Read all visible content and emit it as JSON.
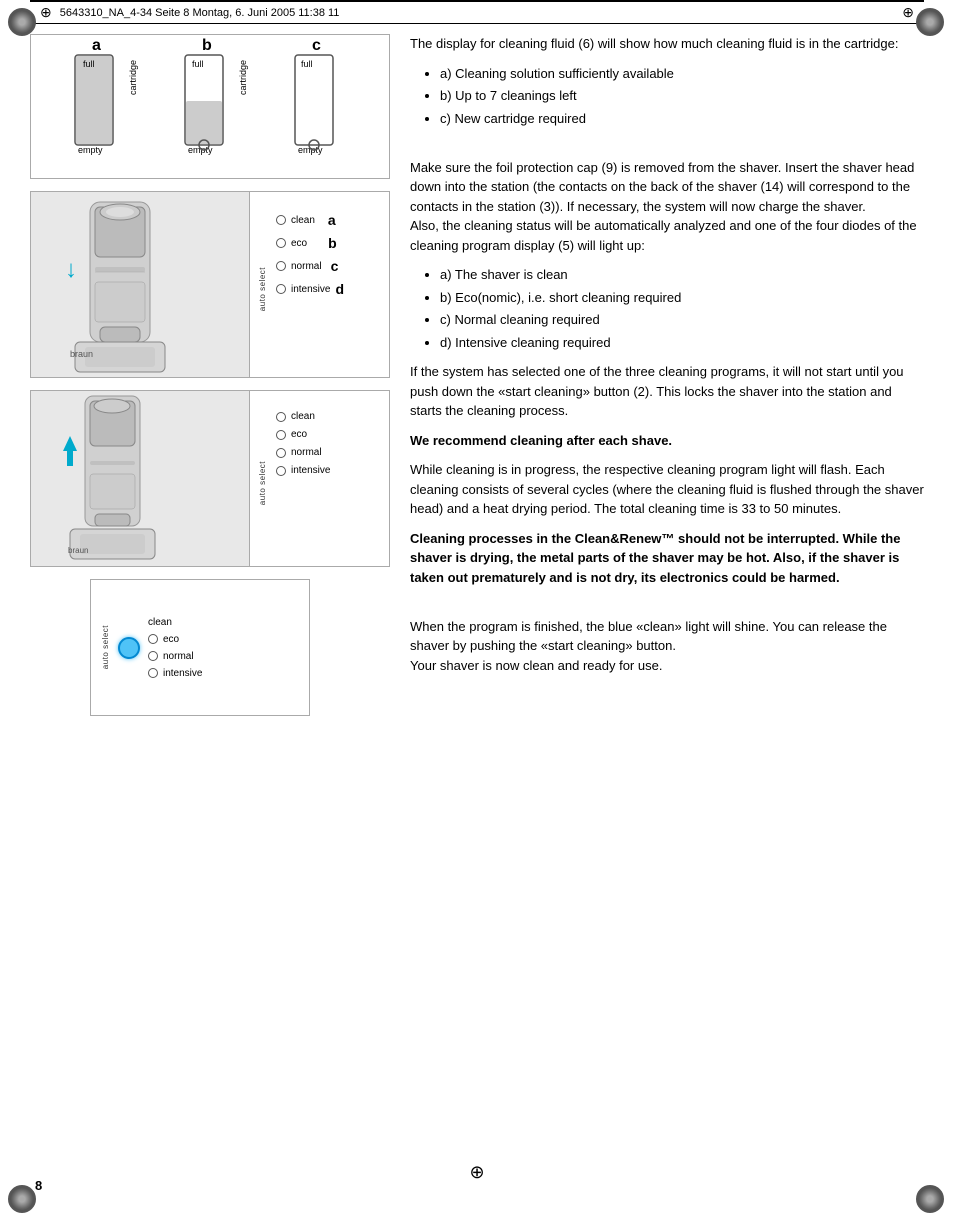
{
  "header": {
    "text": "5643310_NA_4-34  Seite 8  Montag, 6. Juni 2005  11:38 11"
  },
  "page_number": "8",
  "cartridge_section": {
    "items": [
      {
        "letter": "a",
        "level": "full",
        "label_top": "full",
        "label_bottom": "empty"
      },
      {
        "letter": "b",
        "level": "half",
        "label_top": "full",
        "label_bottom": "empty"
      },
      {
        "letter": "c",
        "level": "empty",
        "label_top": "full",
        "label_bottom": "empty"
      }
    ],
    "rotated_label": "cartridge"
  },
  "auto_select_panels": [
    {
      "id": "panel1",
      "items": [
        {
          "label": "clean",
          "active": false,
          "letter": "a"
        },
        {
          "label": "eco",
          "active": false,
          "letter": "b"
        },
        {
          "label": "normal",
          "active": false,
          "letter": "c"
        },
        {
          "label": "intensive",
          "active": false,
          "letter": "d"
        }
      ]
    },
    {
      "id": "panel2",
      "items": [
        {
          "label": "clean",
          "active": false
        },
        {
          "label": "eco",
          "active": false
        },
        {
          "label": "normal",
          "active": false
        },
        {
          "label": "intensive",
          "active": false
        }
      ]
    },
    {
      "id": "panel3",
      "items": [
        {
          "label": "clean",
          "active": true
        },
        {
          "label": "eco",
          "active": false
        },
        {
          "label": "normal",
          "active": false
        },
        {
          "label": "intensive",
          "active": false
        }
      ]
    }
  ],
  "auto_select_label": "auto select",
  "text_content": {
    "para1": "The display for cleaning fluid (6) will show how much cleaning fluid is in the cartridge:",
    "list1": [
      "a)  Cleaning solution sufficiently available",
      "b)  Up to 7 cleanings left",
      "c)  New cartridge required"
    ],
    "para2": "Make sure the foil protection cap (9) is removed from the shaver. Insert the shaver head down into the station (the contacts on the back of  the shaver (14) will correspond to the contacts in the station (3)). If necessary, the system will now charge the shaver.\nAlso, the cleaning status will be automatically analyzed and one of the four diodes of the cleaning program display (5) will light up:",
    "list2": [
      "a)  The shaver is clean",
      "b)  Eco(nomic), i.e. short cleaning required",
      "c)  Normal cleaning required",
      "d)  Intensive cleaning required"
    ],
    "para3": "If the system has selected one of the three cleaning programs, it will not start until you push down the «start cleaning» button (2). This locks the shaver into the station and starts the cleaning process.",
    "para4_bold": "We recommend cleaning after each shave.",
    "para5": "While cleaning is in progress, the respective cleaning program light will flash. Each cleaning consists of several cycles (where the cleaning fluid is flushed through the shaver head) and a heat drying period. The total cleaning time is 33 to 50 minutes.",
    "para6_bold": "Cleaning processes in the Clean&Renew™ should not be interrupted. While the shaver is drying, the metal parts of the shaver may be hot. Also, if the shaver is taken out prematurely and is not dry, its electronics could be harmed.",
    "para7": "When the program is finished, the blue «clean» light will shine. You can release the shaver by pushing the «start cleaning» button.\nYour shaver is now clean and ready for use."
  },
  "icons": {
    "crosshair": "⊕",
    "corner_tl": "crosshair-icon",
    "corner_tr": "crosshair-icon",
    "corner_bl": "crosshair-icon",
    "corner_br": "crosshair-icon"
  }
}
